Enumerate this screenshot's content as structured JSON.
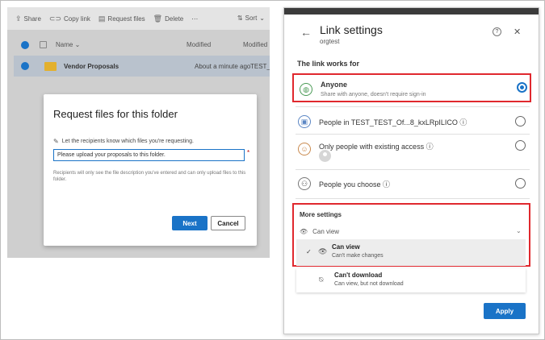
{
  "toolbar": {
    "share": "Share",
    "copy_link": "Copy link",
    "request_files": "Request files",
    "delete": "Delete",
    "more": "⋯",
    "sort": "Sort"
  },
  "list_header": {
    "name": "Name",
    "modified": "Modified",
    "modified_by": "Modified"
  },
  "file_row": {
    "name": "Vendor Proposals",
    "modified": "About a minute ago",
    "modified_by": "TEST_TEST_"
  },
  "request_dialog": {
    "title": "Request files for this folder",
    "instruction": "Let the recipients know which files you're requesting.",
    "input_value": "Please upload your proposals to this folder.",
    "required_marker": "*",
    "note": "Recipients will only see the file description you've entered and can only upload files to this folder.",
    "next_label": "Next",
    "cancel_label": "Cancel"
  },
  "link_settings": {
    "title": "Link settings",
    "subtitle": "orgtest",
    "help": "?",
    "close": "✕",
    "back": "←",
    "works_for_label": "The link works for",
    "options": [
      {
        "label": "Anyone",
        "desc": "Share with anyone, doesn't require sign-in",
        "selected": true
      },
      {
        "label": "People in TEST_TEST_Of...8_kxLRpILICO ⓘ",
        "desc": "",
        "selected": false
      },
      {
        "label": "Only people with existing access ⓘ",
        "desc": "",
        "selected": false
      },
      {
        "label": "People you choose ⓘ",
        "desc": "",
        "selected": false
      }
    ],
    "more_settings_label": "More settings",
    "can_view_dropdown": "Can view",
    "dropdown_items": [
      {
        "label": "Can view",
        "desc": "Can't make changes",
        "selected": true
      },
      {
        "label": "Can't download",
        "desc": "Can view, but not download",
        "selected": false
      }
    ],
    "apply_label": "Apply"
  },
  "colors": {
    "accent": "#1a73c7",
    "highlight_border": "#e0282e",
    "folder": "#e3b02d"
  }
}
